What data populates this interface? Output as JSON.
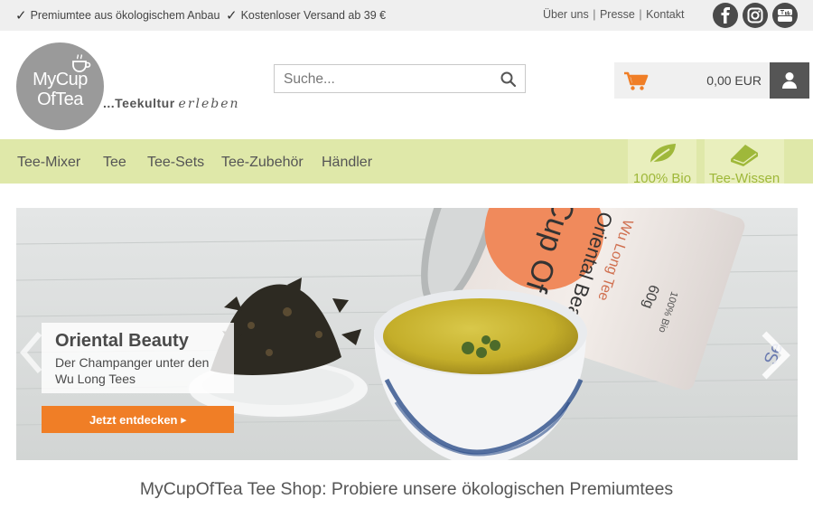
{
  "topbar": {
    "usp1": "Premiumtee aus ökologischem Anbau",
    "usp2": "Kostenloser Versand ab 39 €",
    "links": [
      "Über uns",
      "Presse",
      "Kontakt"
    ],
    "separator": "|",
    "check_glyph": "✓",
    "social_icons": [
      "facebook-icon",
      "instagram-icon",
      "youtube-icon"
    ]
  },
  "header": {
    "logo": {
      "line1": "MyCup",
      "line2": "OfTea"
    },
    "tagline_bold": "...Teekultur",
    "tagline_italic": "erleben",
    "search": {
      "placeholder": "Suche...",
      "value": "",
      "icon": "search-icon"
    },
    "cart": {
      "icon": "cart-icon",
      "total": "0,00 EUR"
    },
    "account": {
      "icon": "user-icon"
    }
  },
  "nav": {
    "items": [
      "Tee-Mixer",
      "Tee",
      "Tee-Sets",
      "Tee-Zubehör",
      "Händler"
    ],
    "special": [
      {
        "label": "100% Bio",
        "icon": "leaf-icon"
      },
      {
        "label": "Tee-Wissen",
        "icon": "book-icon"
      }
    ]
  },
  "hero": {
    "title": "Oriental Beauty",
    "subtitle": "Der Champanger unter den Wu Long Tees",
    "cta": "Jetzt entdecken",
    "cta_arrow": "▸",
    "can_brand": "MyCup Of",
    "can_product": "Oriental Beauty",
    "can_series": "Wu Long Tee",
    "can_weight": "60g",
    "can_bio": "100% Bio",
    "can_side": "Se"
  },
  "headline": "MyCupOfTea Tee Shop: Probiere unsere ökologischen Premiumtees",
  "colors": {
    "topbar_bg": "#efefef",
    "nav_bg": "#dfe8a9",
    "nav_special_bg": "#e9efbd",
    "nav_special_text": "#9fb83a",
    "accent_orange": "#f07e26",
    "logo_gray": "#9a9a9a",
    "account_bg": "#555555"
  }
}
